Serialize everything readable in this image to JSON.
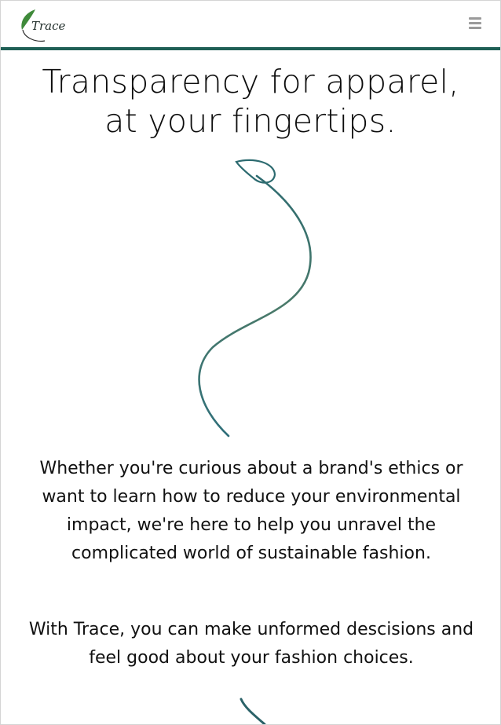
{
  "brand": {
    "name": "Trace",
    "accent_color": "#1f5f55",
    "leaf_color": "#3f8a3a",
    "logo_icon": "leaf-icon"
  },
  "navbar": {
    "menu_icon": "hamburger-menu-icon"
  },
  "hero": {
    "title_line_1": "Transparency for apparel,",
    "title_line_2": "at your fingertips."
  },
  "content": {
    "paragraph_1": "Whether you're curious about a brand's ethics or want to learn how to reduce your environmental impact, we're here to help you unravel the complicated world of sustainable fashion.",
    "paragraph_2": "With Trace, you can make unformed descisions and feel good about your fashion choices."
  },
  "illustration": {
    "icon": "sprout-line-illustration",
    "stroke_color": "#2f6f73"
  }
}
